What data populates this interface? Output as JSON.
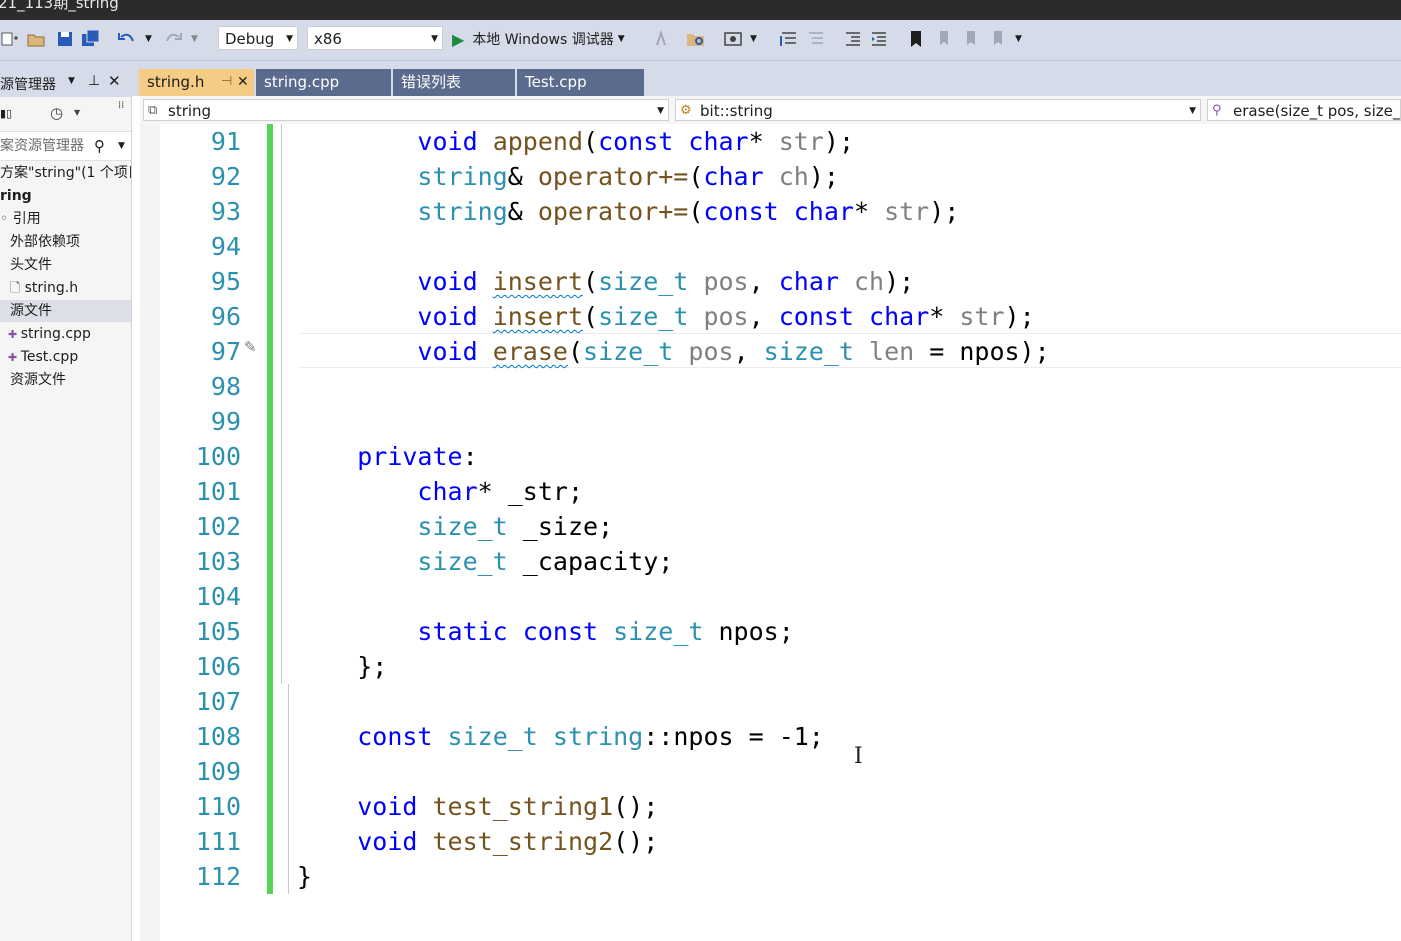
{
  "title_bar": {
    "text": "21_113期_string"
  },
  "toolbar": {
    "config": "Debug",
    "platform": "x86",
    "run_label": "本地 Windows 调试器"
  },
  "solution_explorer": {
    "title": "源管理器",
    "search_placeholder": "案资源管理器",
    "solution": "方案\"string\"(1 个项目",
    "project": "ring",
    "nodes": [
      "引用",
      "外部依赖项",
      "头文件",
      "string.h",
      "源文件",
      "string.cpp",
      "Test.cpp",
      "资源文件"
    ]
  },
  "tabs": [
    {
      "label": "string.h",
      "active": true
    },
    {
      "label": "string.cpp",
      "active": false
    },
    {
      "label": "错误列表",
      "active": false
    },
    {
      "label": "Test.cpp",
      "active": false
    }
  ],
  "navbar": {
    "project_scope": "string",
    "class_scope": "bit::string",
    "member_scope": "erase(size_t pos, size_t"
  },
  "editor": {
    "line_numbers": [
      "91",
      "92",
      "93",
      "94",
      "95",
      "96",
      "97",
      "98",
      "99",
      "100",
      "101",
      "102",
      "103",
      "104",
      "105",
      "106",
      "107",
      "108",
      "109",
      "110",
      "111",
      "112"
    ],
    "lines": [
      [
        [
          "        ",
          ""
        ],
        [
          "void",
          "kw"
        ],
        [
          " ",
          ""
        ],
        [
          "append",
          "fn"
        ],
        [
          "(",
          ""
        ],
        [
          "const",
          "kw"
        ],
        [
          " ",
          ""
        ],
        [
          "char",
          "kw"
        ],
        [
          "* ",
          ""
        ],
        [
          "str",
          "pm"
        ],
        [
          ");",
          ""
        ]
      ],
      [
        [
          "        ",
          ""
        ],
        [
          "string",
          "ty"
        ],
        [
          "& ",
          ""
        ],
        [
          "operator+=",
          "fn"
        ],
        [
          "(",
          ""
        ],
        [
          "char",
          "kw"
        ],
        [
          " ",
          ""
        ],
        [
          "ch",
          "pm"
        ],
        [
          ");",
          ""
        ]
      ],
      [
        [
          "        ",
          ""
        ],
        [
          "string",
          "ty"
        ],
        [
          "& ",
          ""
        ],
        [
          "operator+=",
          "fn"
        ],
        [
          "(",
          ""
        ],
        [
          "const",
          "kw"
        ],
        [
          " ",
          ""
        ],
        [
          "char",
          "kw"
        ],
        [
          "* ",
          ""
        ],
        [
          "str",
          "pm"
        ],
        [
          ");",
          ""
        ]
      ],
      [],
      [
        [
          "        ",
          ""
        ],
        [
          "void",
          "kw"
        ],
        [
          " ",
          ""
        ],
        [
          "insert",
          "fn sq"
        ],
        [
          "(",
          ""
        ],
        [
          "size_t",
          "ty"
        ],
        [
          " ",
          ""
        ],
        [
          "pos",
          "pm"
        ],
        [
          ", ",
          ""
        ],
        [
          "char",
          "kw"
        ],
        [
          " ",
          ""
        ],
        [
          "ch",
          "pm"
        ],
        [
          ");",
          ""
        ]
      ],
      [
        [
          "        ",
          ""
        ],
        [
          "void",
          "kw"
        ],
        [
          " ",
          ""
        ],
        [
          "insert",
          "fn sq"
        ],
        [
          "(",
          ""
        ],
        [
          "size_t",
          "ty"
        ],
        [
          " ",
          ""
        ],
        [
          "pos",
          "pm"
        ],
        [
          ", ",
          ""
        ],
        [
          "const",
          "kw"
        ],
        [
          " ",
          ""
        ],
        [
          "char",
          "kw"
        ],
        [
          "* ",
          ""
        ],
        [
          "str",
          "pm"
        ],
        [
          ");",
          ""
        ]
      ],
      [
        [
          "        ",
          ""
        ],
        [
          "void",
          "kw"
        ],
        [
          " ",
          ""
        ],
        [
          "erase",
          "fn sq"
        ],
        [
          "(",
          ""
        ],
        [
          "size_t",
          "ty"
        ],
        [
          " ",
          ""
        ],
        [
          "pos",
          "pm"
        ],
        [
          ", ",
          ""
        ],
        [
          "size_t",
          "ty"
        ],
        [
          " ",
          ""
        ],
        [
          "len",
          "pm"
        ],
        [
          " = npos);",
          ""
        ]
      ],
      [],
      [],
      [
        [
          "    ",
          ""
        ],
        [
          "private",
          "kw"
        ],
        [
          ":",
          ""
        ]
      ],
      [
        [
          "        ",
          ""
        ],
        [
          "char",
          "kw"
        ],
        [
          "* _str;",
          ""
        ]
      ],
      [
        [
          "        ",
          ""
        ],
        [
          "size_t",
          "ty"
        ],
        [
          " _size;",
          ""
        ]
      ],
      [
        [
          "        ",
          ""
        ],
        [
          "size_t",
          "ty"
        ],
        [
          " _capacity;",
          ""
        ]
      ],
      [],
      [
        [
          "        ",
          ""
        ],
        [
          "static",
          "kw"
        ],
        [
          " ",
          ""
        ],
        [
          "const",
          "kw"
        ],
        [
          " ",
          ""
        ],
        [
          "size_t",
          "ty"
        ],
        [
          " npos;",
          ""
        ]
      ],
      [
        [
          "    };",
          ""
        ]
      ],
      [],
      [
        [
          "    ",
          ""
        ],
        [
          "const",
          "kw"
        ],
        [
          " ",
          ""
        ],
        [
          "size_t",
          "ty"
        ],
        [
          " ",
          ""
        ],
        [
          "string",
          "ty"
        ],
        [
          "::npos = -1;",
          ""
        ]
      ],
      [],
      [
        [
          "    ",
          ""
        ],
        [
          "void",
          "kw"
        ],
        [
          " ",
          ""
        ],
        [
          "test_string1",
          "fn"
        ],
        [
          "();",
          ""
        ]
      ],
      [
        [
          "    ",
          ""
        ],
        [
          "void",
          "kw"
        ],
        [
          " ",
          ""
        ],
        [
          "test_string2",
          "fn"
        ],
        [
          "();",
          ""
        ]
      ],
      [
        [
          "}",
          ""
        ]
      ]
    ]
  }
}
